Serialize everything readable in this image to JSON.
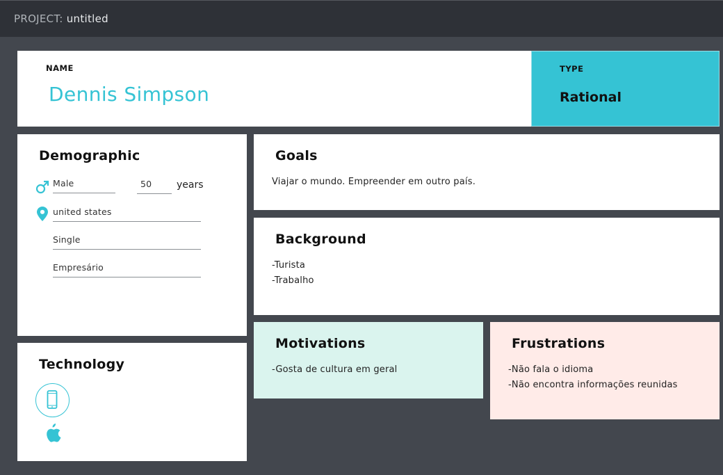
{
  "header": {
    "project_label": "PROJECT:",
    "project_name": "untitled"
  },
  "persona": {
    "name_label": "NAME",
    "name": "Dennis Simpson",
    "type_label": "TYPE",
    "type": "Rational"
  },
  "demographic": {
    "title": "Demographic",
    "gender": "Male",
    "age": "50",
    "age_unit": "years",
    "location": "united states",
    "status": "Single",
    "occupation": "Empresário"
  },
  "technology": {
    "title": "Technology",
    "icons": [
      "smartphone-icon",
      "apple-icon"
    ]
  },
  "goals": {
    "title": "Goals",
    "lines": [
      "Viajar o mundo. Empreender em outro país."
    ]
  },
  "background": {
    "title": "Background",
    "lines": [
      "-Turista",
      "-Trabalho"
    ]
  },
  "motivations": {
    "title": "Motivations",
    "lines": [
      "-Gosta de cultura em geral"
    ]
  },
  "frustrations": {
    "title": "Frustrations",
    "lines": [
      "-Não fala o idioma",
      "-Não encontra informações reunidas"
    ]
  },
  "colors": {
    "accent": "#35c3d4",
    "background": "#43474e",
    "topbar": "#2e3137",
    "motivations_bg": "#daf4ee",
    "frustrations_bg": "#ffebe8"
  }
}
